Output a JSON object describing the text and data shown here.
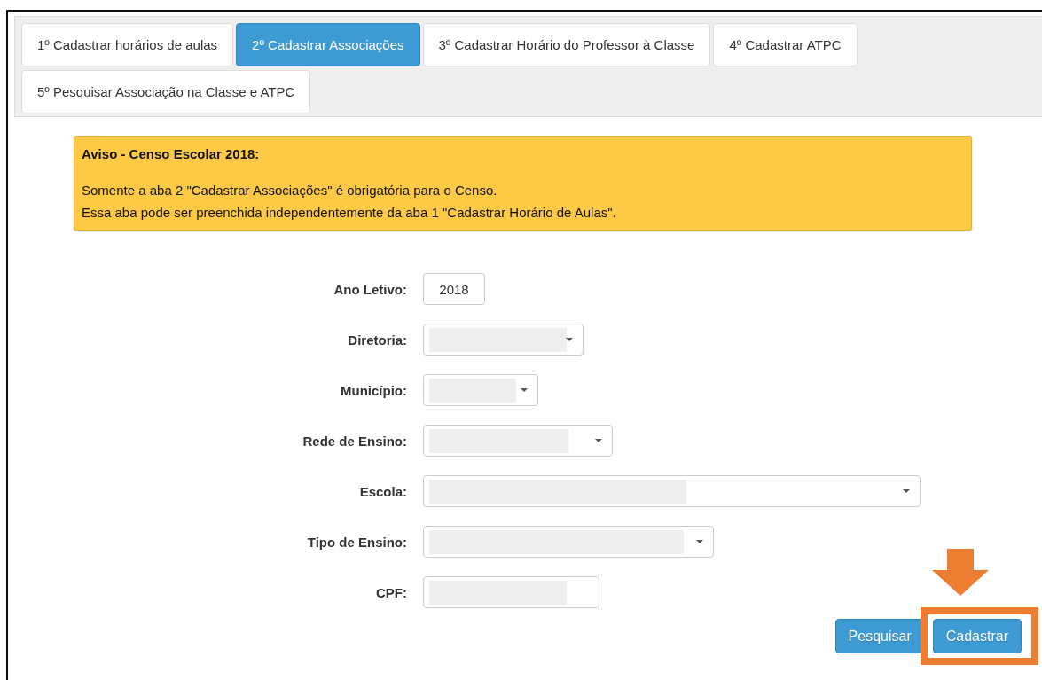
{
  "tabs": [
    {
      "label": "1º Cadastrar horários de aulas",
      "selected": false
    },
    {
      "label": "2º Cadastrar Associações",
      "selected": true
    },
    {
      "label": "3º Cadastrar Horário do Professor à Classe",
      "selected": false
    },
    {
      "label": "4º Cadastrar ATPC",
      "selected": false
    },
    {
      "label": "5º Pesquisar Associação na Classe e ATPC",
      "selected": false
    }
  ],
  "notice": {
    "title": "Aviso - Censo Escolar 2018:",
    "lines": [
      "Somente a aba 2 \"Cadastrar Associações\" é obrigatória para o Censo.",
      "Essa aba pode ser preenchida independentemente da aba 1 \"Cadastrar Horário de Aulas\"."
    ]
  },
  "fields": [
    {
      "label": "Ano Letivo:",
      "kind": "text",
      "value": "2018",
      "masked": false
    },
    {
      "label": "Diretoria:",
      "kind": "select",
      "masked": true
    },
    {
      "label": "Município:",
      "kind": "select",
      "masked": true
    },
    {
      "label": "Rede de Ensino:",
      "kind": "select",
      "masked": true
    },
    {
      "label": "Escola:",
      "kind": "select",
      "masked": true
    },
    {
      "label": "Tipo de Ensino:",
      "kind": "select",
      "masked": true
    },
    {
      "label": "CPF:",
      "kind": "text",
      "masked": true
    }
  ],
  "buttons": [
    {
      "label": "Pesquisar",
      "highlighted": false
    },
    {
      "label": "Cadastrar",
      "highlighted": true
    }
  ]
}
